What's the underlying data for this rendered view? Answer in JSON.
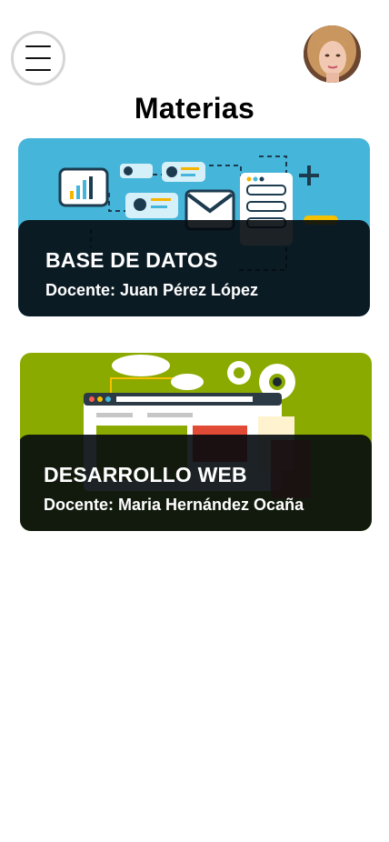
{
  "header": {
    "menu_icon": "hamburger-icon",
    "title": "Materias"
  },
  "courses": [
    {
      "title": "BASE DE DATOS",
      "teacher": "Docente: Juan Pérez López",
      "color": "#45b5d9"
    },
    {
      "title": "DESARROLLO WEB",
      "teacher": "Docente: Maria Hernández Ocaña",
      "color": "#8aaa00"
    }
  ]
}
